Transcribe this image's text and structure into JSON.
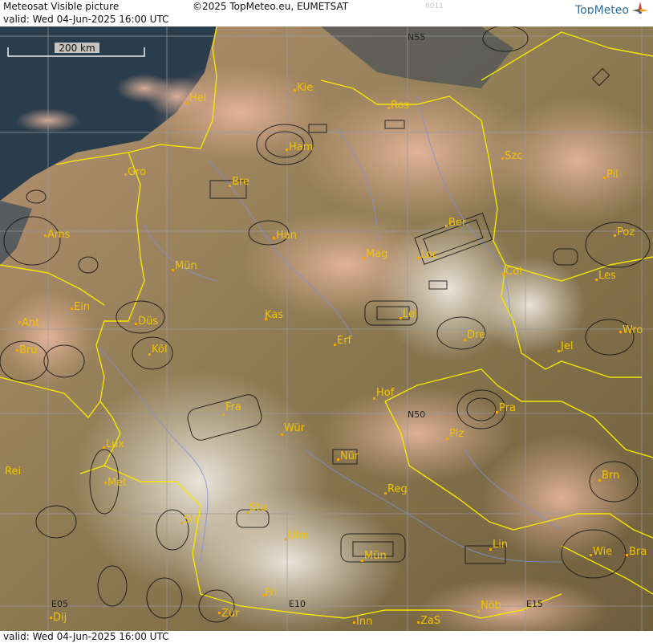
{
  "header": {
    "title": "Meteosat Visible picture",
    "copyright": "©2025 TopMeteo.eu, EUMETSAT",
    "faint_code": "8011",
    "valid": "valid:  Wed  04-Jun-2025  16:00 UTC",
    "brand": "TopMeteo"
  },
  "scale_bar": {
    "label": "200 km"
  },
  "footer": {
    "valid": "valid:  Wed  04-Jun-2025  16:00 UTC"
  },
  "grid_labels": {
    "n55": "N55",
    "n50": "N50",
    "e05": "E05",
    "e10": "E10",
    "e15": "E15"
  },
  "cities": {
    "kie": "Kie",
    "hel": "Hel",
    "ros": "Ros",
    "ham": "Ham",
    "szc": "Szc",
    "pil": "Pil",
    "gro": "Gro",
    "bre": "Bre",
    "ams": "Ams",
    "han": "Han",
    "ber": "Ber",
    "poz": "Poz",
    "mun_n": "Mün",
    "mag": "Mag",
    "loc": "Loc",
    "cot": "Cot",
    "les": "Les",
    "ein": "Ein",
    "ant": "Ant",
    "dus": "Düs",
    "kas": "Kas",
    "lei": "Lei",
    "wro": "Wro",
    "bru": "Bru",
    "kol": "Köl",
    "erf": "Erf",
    "dre": "Dre",
    "jel": "Jel",
    "hof": "Hof",
    "fra": "Fra",
    "pra": "Pra",
    "wur": "Wür",
    "lux": "Lux",
    "plz": "Plz",
    "nur": "Nür",
    "rei": "Rei",
    "met": "Met",
    "reg": "Reg",
    "brn": "Brn",
    "str": "Str",
    "stu": "Stu",
    "ulm": "Ulm",
    "lin": "Lin",
    "mun_s": "Mün",
    "wie": "Wie",
    "bra": "Bra",
    "fri": "Fri",
    "dij": "Dij",
    "zur": "Zür",
    "inn": "Inn",
    "zas": "ZaS",
    "nob": "Nöb"
  },
  "colors": {
    "border": "#f5e600",
    "city": "#f2c400",
    "sea": "#2a3d4d",
    "grid": "#9a9a9a"
  }
}
